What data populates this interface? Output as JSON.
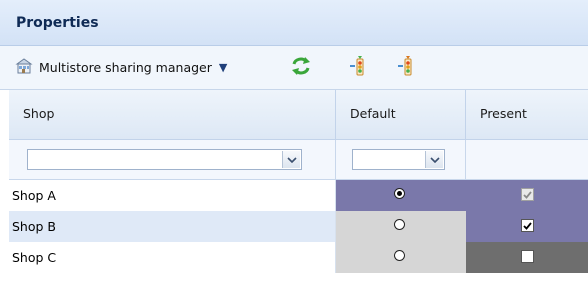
{
  "panel": {
    "title": "Properties"
  },
  "toolbar": {
    "sharing_manager_label": "Multistore sharing manager"
  },
  "grid": {
    "columns": [
      "Shop",
      "Default",
      "Present"
    ],
    "filters": {
      "shop_value": "",
      "default_value": ""
    },
    "rows": [
      {
        "shop": "Shop A",
        "default_selected": true,
        "present_checked": true,
        "present_disabled": true
      },
      {
        "shop": "Shop B",
        "default_selected": false,
        "present_checked": true,
        "present_disabled": false
      },
      {
        "shop": "Shop C",
        "default_selected": false,
        "present_checked": false,
        "present_disabled": false
      }
    ]
  },
  "colors": {
    "shop_row_a": "#ffffff",
    "shop_row_b": "#dfe9f7",
    "shop_row_c": "#ffffff",
    "default_row_a": "#7a78aa",
    "default_row_bc": "#d6d6d6",
    "present_row_ab": "#7a78aa",
    "present_row_c": "#6e6e6e"
  }
}
